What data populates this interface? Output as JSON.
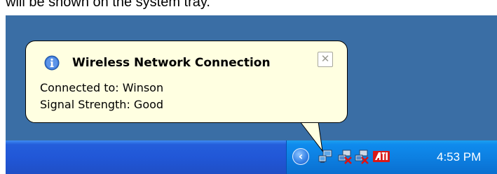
{
  "caption": "will be shown on the system tray.",
  "balloon": {
    "title": "Wireless Network Connection",
    "close_glyph": "✕",
    "line1": "Connected to: Winson",
    "line2": "Signal Strength: Good"
  },
  "tray": {
    "chevron_glyph": "‹",
    "clock": "4:53 PM",
    "icons": [
      "wireless-connected-icon",
      "network-disconnected-icon",
      "network-disconnected-icon",
      "ati-icon"
    ]
  },
  "colors": {
    "desktop": "#3a6ea5",
    "taskbar": "#2157d7",
    "tray": "#0d80e2",
    "balloon": "#ffffe1"
  }
}
